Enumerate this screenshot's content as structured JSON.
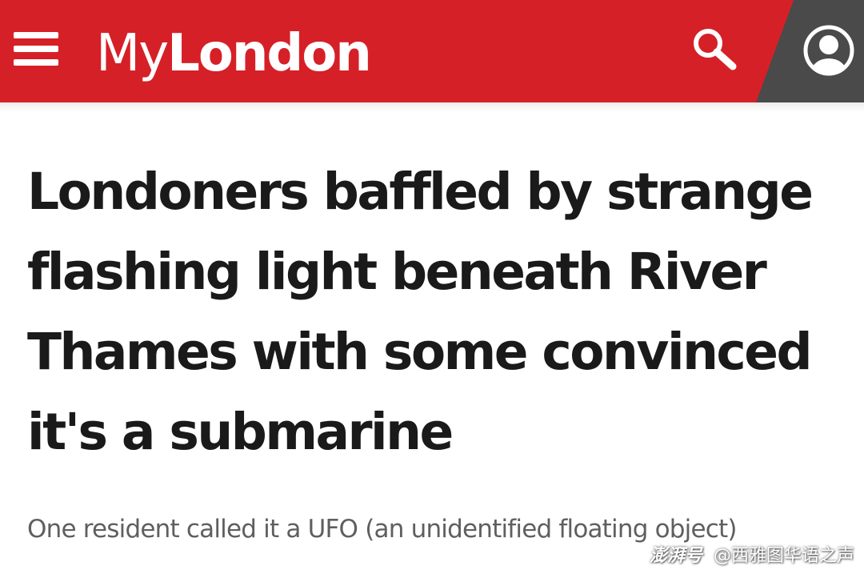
{
  "colors": {
    "brand_red": "#d62027",
    "header_shade": "#4a4a4a",
    "headline_text": "#1a1a1a",
    "standfirst_text": "#5f5f5f"
  },
  "header": {
    "menu_icon": "hamburger-menu-icon",
    "logo_part1": "My",
    "logo_part2": "London",
    "search_icon": "search-icon",
    "account_icon": "user-account-icon"
  },
  "article": {
    "headline": "Londoners baffled by strange flashing light beneath River Thames with some convinced it's a submarine",
    "standfirst": "One resident called it a UFO (an unidentified floating object)"
  },
  "watermark": {
    "brand": "澎湃号",
    "account": "@西雅图华语之声"
  }
}
